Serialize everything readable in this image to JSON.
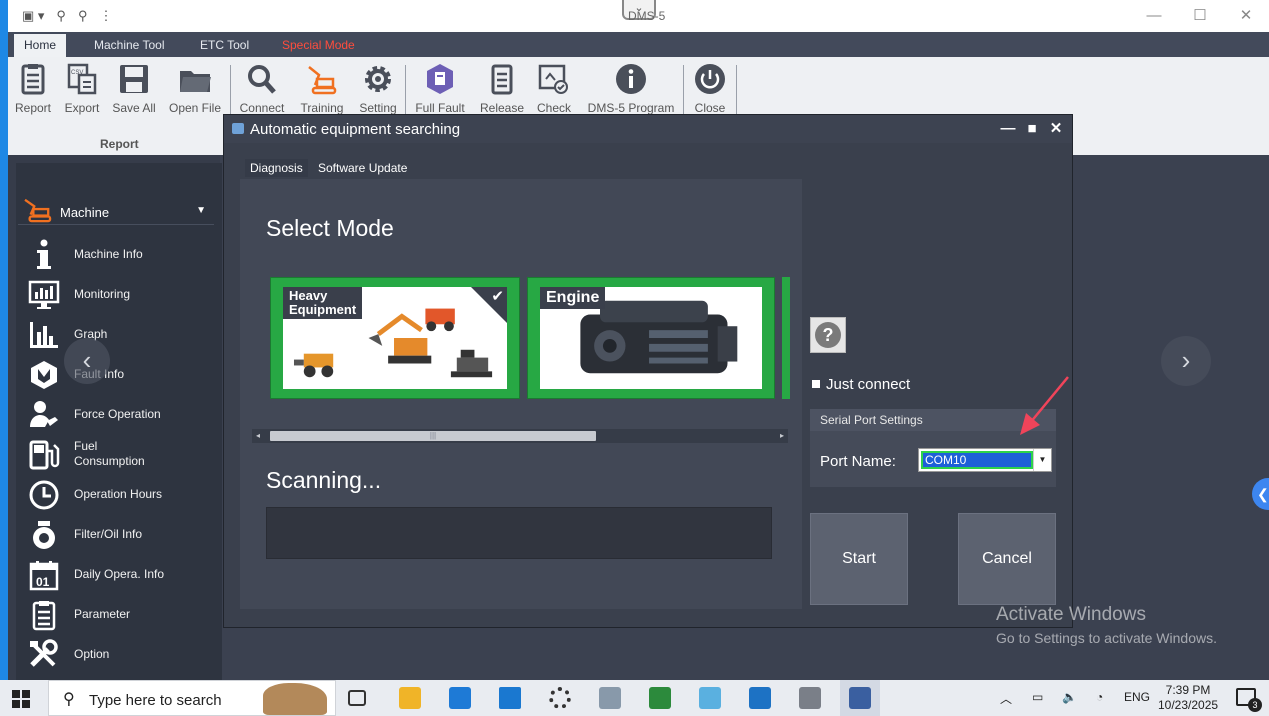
{
  "window": {
    "title": "DMS-5",
    "collapse_glyph": "⌄",
    "controls": [
      "—",
      "☐",
      "✕"
    ]
  },
  "quick_access": [
    "▣ ▾",
    "⚲",
    "⚲",
    "⋮"
  ],
  "ribbon_tabs": [
    {
      "label": "Home",
      "active": true
    },
    {
      "label": "Machine Tool"
    },
    {
      "label": "ETC Tool"
    },
    {
      "label": "Special Mode",
      "color": "#ff4d3d"
    }
  ],
  "ribbon_buttons": [
    {
      "label": "Report",
      "icon": "clipboard-icon"
    },
    {
      "label": "Export",
      "icon": "csv-export-icon"
    },
    {
      "label": "Save All",
      "icon": "save-icon"
    },
    {
      "label": "Open File",
      "icon": "folder-icon"
    },
    {
      "label": "Connect",
      "icon": "search-icon"
    },
    {
      "label": "Training",
      "icon": "excavator-icon"
    },
    {
      "label": "Setting",
      "icon": "gear-icon"
    },
    {
      "label": "Full Fault",
      "icon": "fault-shield-icon"
    },
    {
      "label": "Release",
      "icon": "release-list-icon"
    },
    {
      "label": "Check",
      "icon": "check-image-icon"
    },
    {
      "label": "DMS-5 Program",
      "icon": "info-icon"
    },
    {
      "label": "Close",
      "icon": "power-icon"
    }
  ],
  "ribbon_group_label": "Report",
  "sidebar": {
    "header": "Machine",
    "header_arrow": "▼",
    "items": [
      {
        "label": "Machine Info",
        "icon": "info-i-icon"
      },
      {
        "label": "Monitoring",
        "icon": "monitor-icon"
      },
      {
        "label": "Graph",
        "icon": "bar-graph-icon"
      },
      {
        "label": "Fault Info",
        "icon": "fault-icon"
      },
      {
        "label": "Force Operation",
        "icon": "force-operation-icon"
      },
      {
        "label": "Fuel\nConsumption",
        "icon": "fuel-icon"
      },
      {
        "label": "Operation Hours",
        "icon": "clock-icon"
      },
      {
        "label": "Filter/Oil Info",
        "icon": "oil-drop-icon"
      },
      {
        "label": "Daily Opera. Info",
        "icon": "calendar-icon"
      },
      {
        "label": "Parameter",
        "icon": "parameter-icon"
      },
      {
        "label": "Option",
        "icon": "tools-icon"
      }
    ]
  },
  "nav": {
    "prev": "‹",
    "next": "›",
    "side_handle": "❮"
  },
  "dialog": {
    "title": "Automatic equipment searching",
    "controls": [
      "—",
      "■",
      "✕"
    ],
    "tabs": [
      "Diagnosis",
      "Software Update"
    ],
    "select_mode_label": "Select Mode",
    "cards": [
      {
        "label": "Heavy\nEquipment",
        "selected": true,
        "check": "✔"
      },
      {
        "label": "Engine",
        "selected": false
      }
    ],
    "scroll": {
      "left": "◂",
      "right": "▸",
      "grip": "|||"
    },
    "scanning_label": "Scanning...",
    "help": "?",
    "just_connect": "Just connect",
    "serial_port_header": "Serial Port Settings",
    "port_name_label": "Port Name:",
    "port_name_value": "COM10",
    "port_dropdown": "▼",
    "start_button": "Start",
    "cancel_button": "Cancel"
  },
  "watermark": {
    "line1": "Activate Windows",
    "line2": "Go to Settings to activate Windows."
  },
  "taskbar": {
    "search_placeholder": "Type here to search",
    "search_glyph": "⚲",
    "tray": {
      "caret": "︿",
      "battery": "▭",
      "volume": "🔈",
      "wifi": "◔",
      "lang": "ENG"
    },
    "time": "7:39 PM",
    "date": "10/23/2025",
    "notifications": "3"
  }
}
